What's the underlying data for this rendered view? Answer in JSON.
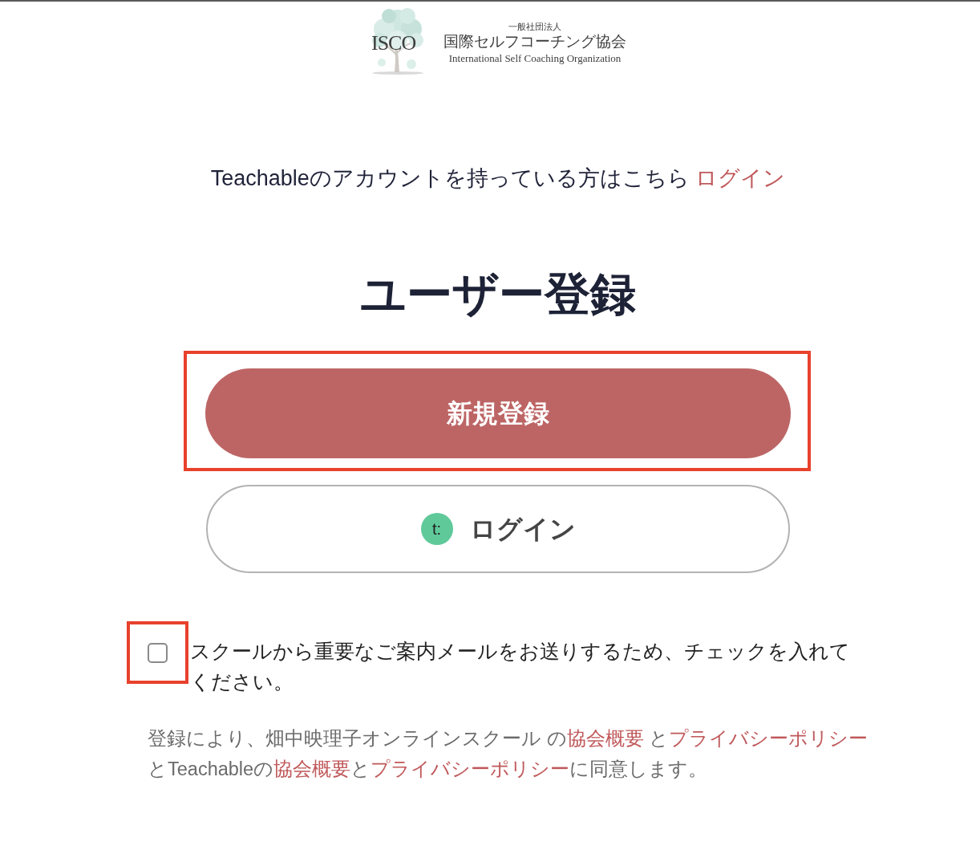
{
  "header": {
    "logo": {
      "mark": "ISCO",
      "prefix": "一般社団法人",
      "name": "国際セルフコーチング協会",
      "english": "International Self Coaching Organization"
    }
  },
  "account_prompt": {
    "text": "Teachableのアカウントを持っている方はこちら",
    "link": "ログイン"
  },
  "title": "ユーザー登録",
  "signup_button": {
    "label": "新規登録",
    "highlighted": true
  },
  "login_button": {
    "badge": "t:",
    "label": "ログイン"
  },
  "consent": {
    "checked": false,
    "highlighted": true,
    "label": "スクールから重要なご案内メールをお送りするため、チェックを入れてください。"
  },
  "terms": [
    {
      "kind": "text",
      "text": "登録により、畑中映理子オンラインスクール の"
    },
    {
      "kind": "link",
      "text": "協会概要"
    },
    {
      "kind": "text",
      "text": " と"
    },
    {
      "kind": "link",
      "text": "プライバシーポリシー"
    },
    {
      "kind": "text",
      "text": "とTeachableの"
    },
    {
      "kind": "link",
      "text": "協会概要"
    },
    {
      "kind": "text",
      "text": "と"
    },
    {
      "kind": "link",
      "text": "プライバシーポリシー"
    },
    {
      "kind": "text",
      "text": "に同意します。"
    }
  ]
}
